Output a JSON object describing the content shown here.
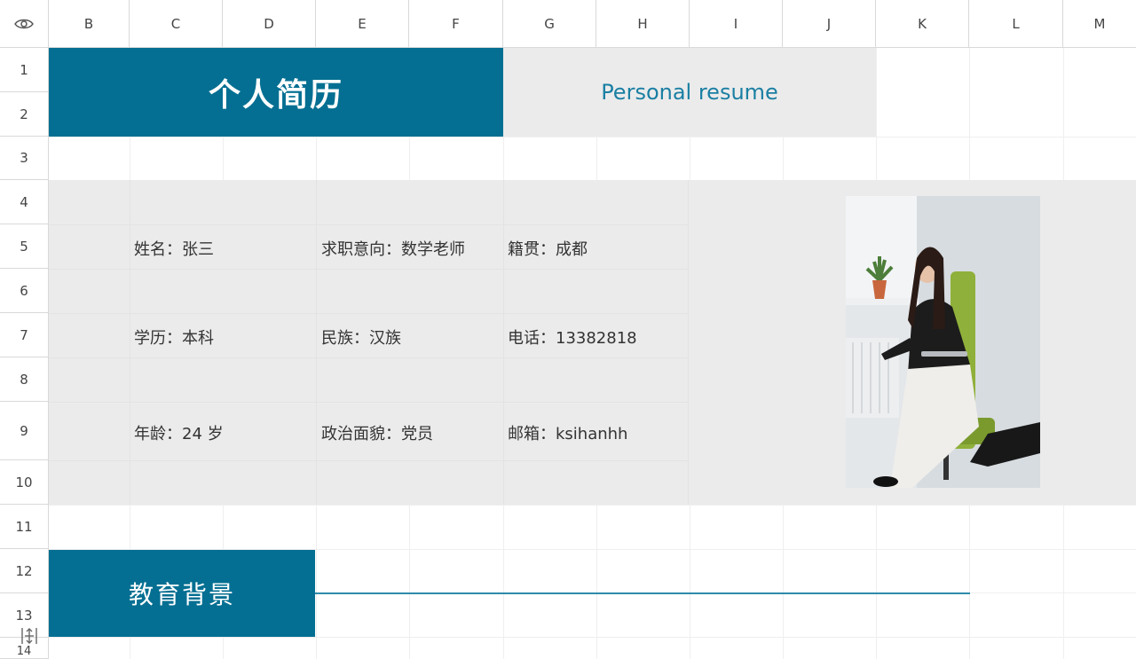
{
  "columns": [
    "B",
    "C",
    "D",
    "E",
    "F",
    "G",
    "H",
    "I",
    "J",
    "K",
    "L",
    "M"
  ],
  "rows": [
    "1",
    "2",
    "3",
    "4",
    "5",
    "6",
    "7",
    "8",
    "9",
    "10",
    "11",
    "12",
    "13",
    "14"
  ],
  "header": {
    "title": "个人简历",
    "subtitle": "Personal resume"
  },
  "info": {
    "name": "姓名：张三",
    "job": "求职意向：数学老师",
    "origin": "籍贯：成都",
    "education": "学历：本科",
    "ethnicity": "民族：汉族",
    "phone": "电话：13382818",
    "age": "年龄：24 岁",
    "politics": "政治面貌：党员",
    "email": "邮箱：ksihanhh"
  },
  "section": {
    "education_title": "教育背景"
  },
  "colors": {
    "accent": "#046f92",
    "accent_text": "#1a7fa3",
    "panel": "#ebebeb"
  },
  "icons": {
    "corner": "eye-icon",
    "freeze": "freeze-panes-icon"
  }
}
